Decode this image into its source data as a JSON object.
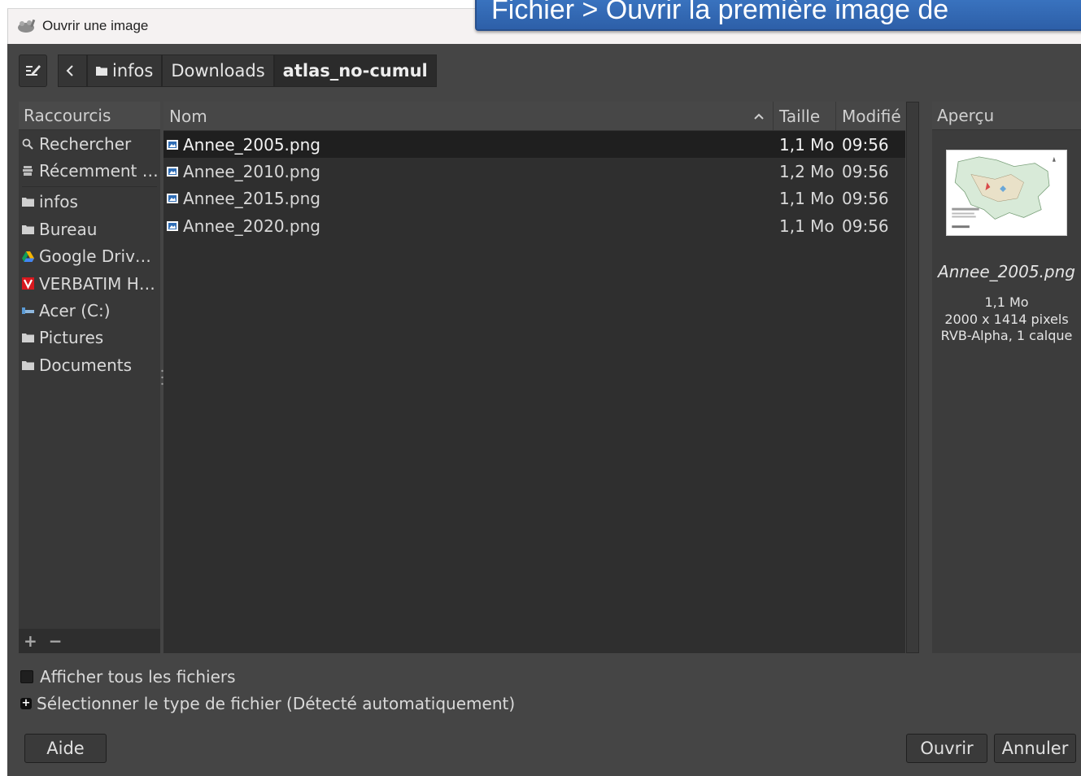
{
  "window": {
    "title": "Ouvrir une image",
    "banner_text": "Fichier > Ouvrir la première image de"
  },
  "toolbar": {
    "edit_location_icon": "edit-location-icon",
    "back_icon": "chevron-left-icon",
    "breadcrumbs": [
      {
        "label": "infos",
        "icon": "folder-icon"
      },
      {
        "label": "Downloads"
      },
      {
        "label": "atlas_no-cumul",
        "active": true
      }
    ]
  },
  "places": {
    "header": "Raccourcis",
    "items": [
      {
        "label": "Rechercher",
        "icon": "search-icon"
      },
      {
        "label": "Récemment …",
        "icon": "recent-icon"
      },
      {
        "label": "infos",
        "icon": "folder-icon"
      },
      {
        "label": "Bureau",
        "icon": "folder-icon"
      },
      {
        "label": "Google Driv…",
        "icon": "google-drive-icon"
      },
      {
        "label": "VERBATIM H…",
        "icon": "verbatim-drive-icon"
      },
      {
        "label": "Acer (C:)",
        "icon": "drive-icon"
      },
      {
        "label": "Pictures",
        "icon": "folder-icon"
      },
      {
        "label": "Documents",
        "icon": "folder-icon"
      }
    ],
    "add_label": "+",
    "remove_label": "−"
  },
  "files": {
    "columns": {
      "name": "Nom",
      "size": "Taille",
      "modified": "Modifié"
    },
    "sort_icon": "sort-ascending-icon",
    "rows": [
      {
        "name": "Annee_2005.png",
        "size": "1,1 Mo",
        "modified": "09:56",
        "selected": true
      },
      {
        "name": "Annee_2010.png",
        "size": "1,2 Mo",
        "modified": "09:56"
      },
      {
        "name": "Annee_2015.png",
        "size": "1,1 Mo",
        "modified": "09:56"
      },
      {
        "name": "Annee_2020.png",
        "size": "1,1 Mo",
        "modified": "09:56"
      }
    ]
  },
  "preview": {
    "header": "Aperçu",
    "filename": "Annee_2005.png",
    "size": "1,1 Mo",
    "dimensions": "2000 x 1414 pixels",
    "mode": "RVB-Alpha, 1 calque"
  },
  "options": {
    "show_all_files": "Afficher tous les fichiers",
    "file_type": "Sélectionner le type de fichier (Détecté automatiquement)"
  },
  "buttons": {
    "help": "Aide",
    "open": "Ouvrir",
    "cancel": "Annuler"
  },
  "colors": {
    "dialog_bg": "#454545",
    "file_list_bg": "#2f2f2f",
    "banner_bg": "#3a72c0",
    "selected_row_bg": "#1f1f1f"
  }
}
